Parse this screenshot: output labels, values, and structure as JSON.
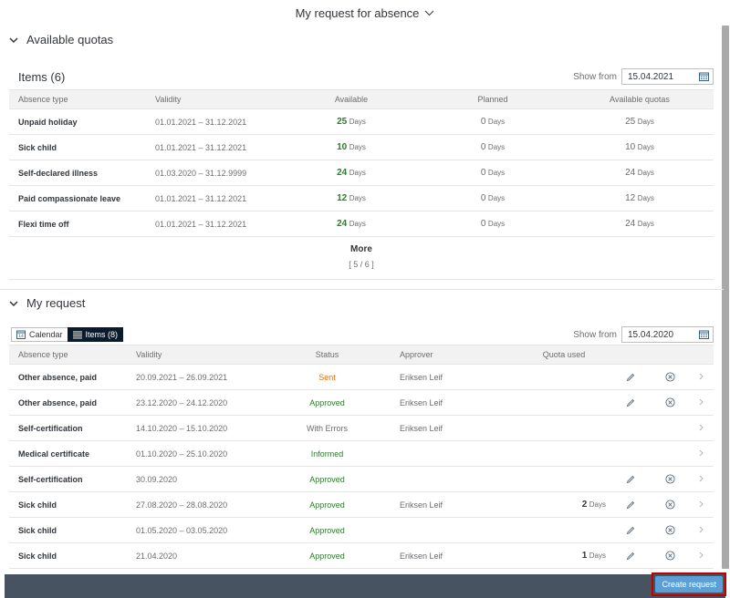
{
  "header": {
    "title": "My request for absence"
  },
  "quotas": {
    "section_title": "Available quotas",
    "items_title": "Items (6)",
    "show_from_label": "Show from",
    "show_from_value": "15.04.2021",
    "columns": [
      "Absence type",
      "Validity",
      "Available",
      "Planned",
      "Available quotas"
    ],
    "rows": [
      {
        "type": "Unpaid holiday",
        "validity": "01.01.2021 – 31.12.2021",
        "available": "25",
        "planned": "0",
        "quota": "25",
        "unit": "Days"
      },
      {
        "type": "Sick child",
        "validity": "01.01.2021 – 31.12.2021",
        "available": "10",
        "planned": "0",
        "quota": "10",
        "unit": "Days"
      },
      {
        "type": "Self-declared illness",
        "validity": "01.03.2020 – 31.12.9999",
        "available": "24",
        "planned": "0",
        "quota": "24",
        "unit": "Days"
      },
      {
        "type": "Paid compassionate leave",
        "validity": "01.01.2021 – 31.12.2021",
        "available": "12",
        "planned": "0",
        "quota": "12",
        "unit": "Days"
      },
      {
        "type": "Flexi time off",
        "validity": "01.01.2021 – 31.12.2021",
        "available": "24",
        "planned": "0",
        "quota": "24",
        "unit": "Days"
      }
    ],
    "more_label": "More",
    "more_count": "[ 5 / 6 ]"
  },
  "requests": {
    "section_title": "My request",
    "tab_calendar": "Calendar",
    "tab_items": "Items (8)",
    "show_from_label": "Show from",
    "show_from_value": "15.04.2020",
    "columns": [
      "Absence type",
      "Validity",
      "Status",
      "Approver",
      "Quota used"
    ],
    "rows": [
      {
        "type": "Other absence, paid",
        "validity": "20.09.2021 – 26.09.2021",
        "status": "Sent",
        "status_kind": "sent",
        "approver": "Eriksen Leif",
        "quota": "",
        "unit": "",
        "editable": true
      },
      {
        "type": "Other absence, paid",
        "validity": "23.12.2020 – 24.12.2020",
        "status": "Approved",
        "status_kind": "green",
        "approver": "Eriksen Leif",
        "quota": "",
        "unit": "",
        "editable": true
      },
      {
        "type": "Self-certification",
        "validity": "14.10.2020 – 15.10.2020",
        "status": "With Errors",
        "status_kind": "err",
        "approver": "Eriksen Leif",
        "quota": "",
        "unit": "",
        "editable": false
      },
      {
        "type": "Medical certificate",
        "validity": "01.10.2020 – 25.10.2020",
        "status": "Informed",
        "status_kind": "green",
        "approver": "",
        "quota": "",
        "unit": "",
        "editable": false
      },
      {
        "type": "Self-certification",
        "validity": "30.09.2020",
        "status": "Approved",
        "status_kind": "green",
        "approver": "",
        "quota": "",
        "unit": "",
        "editable": true
      },
      {
        "type": "Sick child",
        "validity": "27.08.2020 – 28.08.2020",
        "status": "Approved",
        "status_kind": "green",
        "approver": "Eriksen Leif",
        "quota": "2",
        "unit": "Days",
        "editable": true
      },
      {
        "type": "Sick child",
        "validity": "01.05.2020 – 03.05.2020",
        "status": "Approved",
        "status_kind": "green",
        "approver": "",
        "quota": "",
        "unit": "",
        "editable": true
      },
      {
        "type": "Sick child",
        "validity": "21.04.2020",
        "status": "Approved",
        "status_kind": "green",
        "approver": "Eriksen Leif",
        "quota": "1",
        "unit": "Days",
        "editable": true
      }
    ]
  },
  "footer": {
    "create_label": "Create request"
  },
  "colors": {
    "positive": "#2b7c2b",
    "warning": "#df6e0c",
    "footer_bg": "#475360",
    "primary_button": "#5b9fd6",
    "highlight_border": "#c00000"
  }
}
